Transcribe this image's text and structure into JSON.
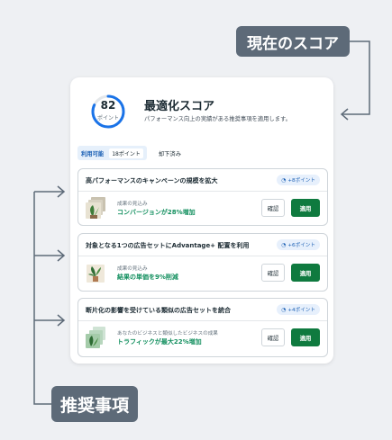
{
  "callouts": {
    "current_score": "現在のスコア",
    "recommendations": "推奨事項"
  },
  "score": {
    "value": "82",
    "unit": "ポイント",
    "fraction": 0.82,
    "ring_color": "#1a73e8"
  },
  "header": {
    "title": "最適化スコア",
    "subtitle": "パフォーマンス向上の実績がある推奨事項を適用します。"
  },
  "tabs": {
    "available_label": "利用可能",
    "available_count": "18ポイント",
    "rejected_label": "却下済み"
  },
  "cards": [
    {
      "title": "高パフォーマンスのキャンペーンの規模を拡大",
      "badge": "+8ポイント",
      "effect_label": "成果の見込み",
      "effect_value": "コンバージョンが28%増加",
      "review_label": "確認",
      "apply_label": "適用"
    },
    {
      "title": "対象となる1つの広告セットにAdvantage+ 配置を利用",
      "badge": "+6ポイント",
      "effect_label": "成果の見込み",
      "effect_value": "結果の単価を9%削減",
      "review_label": "確認",
      "apply_label": "適用"
    },
    {
      "title": "断片化の影響を受けている類似の広告セットを統合",
      "badge": "+4ポイント",
      "effect_label": "あなたのビジネスと類似したビジネスの成果",
      "effect_value": "トラフィックが最大22%増加",
      "review_label": "確認",
      "apply_label": "適用"
    }
  ],
  "colors": {
    "accent": "#1a5fb4",
    "success": "#128f5e",
    "apply_button": "#0f7a3f",
    "callout_bg": "#5d6a78"
  },
  "icons": {
    "badge": "gauge-icon",
    "thumb": "plant-photo-thumbnail"
  }
}
